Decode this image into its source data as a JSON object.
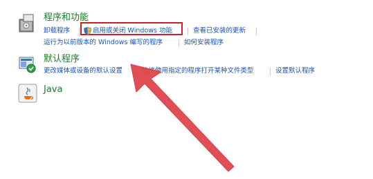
{
  "programs": {
    "title": "程序和功能",
    "icon": "programs-features-icon",
    "links": {
      "uninstall": "卸载程序",
      "toggle_features": "启用或关闭 Windows 功能",
      "view_updates": "查看已安装的更新",
      "run_old_programs": "运行为以前版本的 Windows 编写的程序",
      "how_to_install": "如何安装程序"
    }
  },
  "defaults": {
    "title": "默认程序",
    "icon": "default-programs-icon",
    "links": {
      "change_media": "更改媒体或设备的默认设置",
      "file_types": "始终使用指定的程序打开某种文件类型",
      "set_defaults": "设置默认程序"
    }
  },
  "java": {
    "title": "Java",
    "icon": "java-icon"
  },
  "annotation": {
    "highlight_color": "#c8202a",
    "arrow_color": "#e0454a"
  },
  "colors": {
    "title_green": "#1e7a2e",
    "link_blue": "#1a56b5"
  }
}
